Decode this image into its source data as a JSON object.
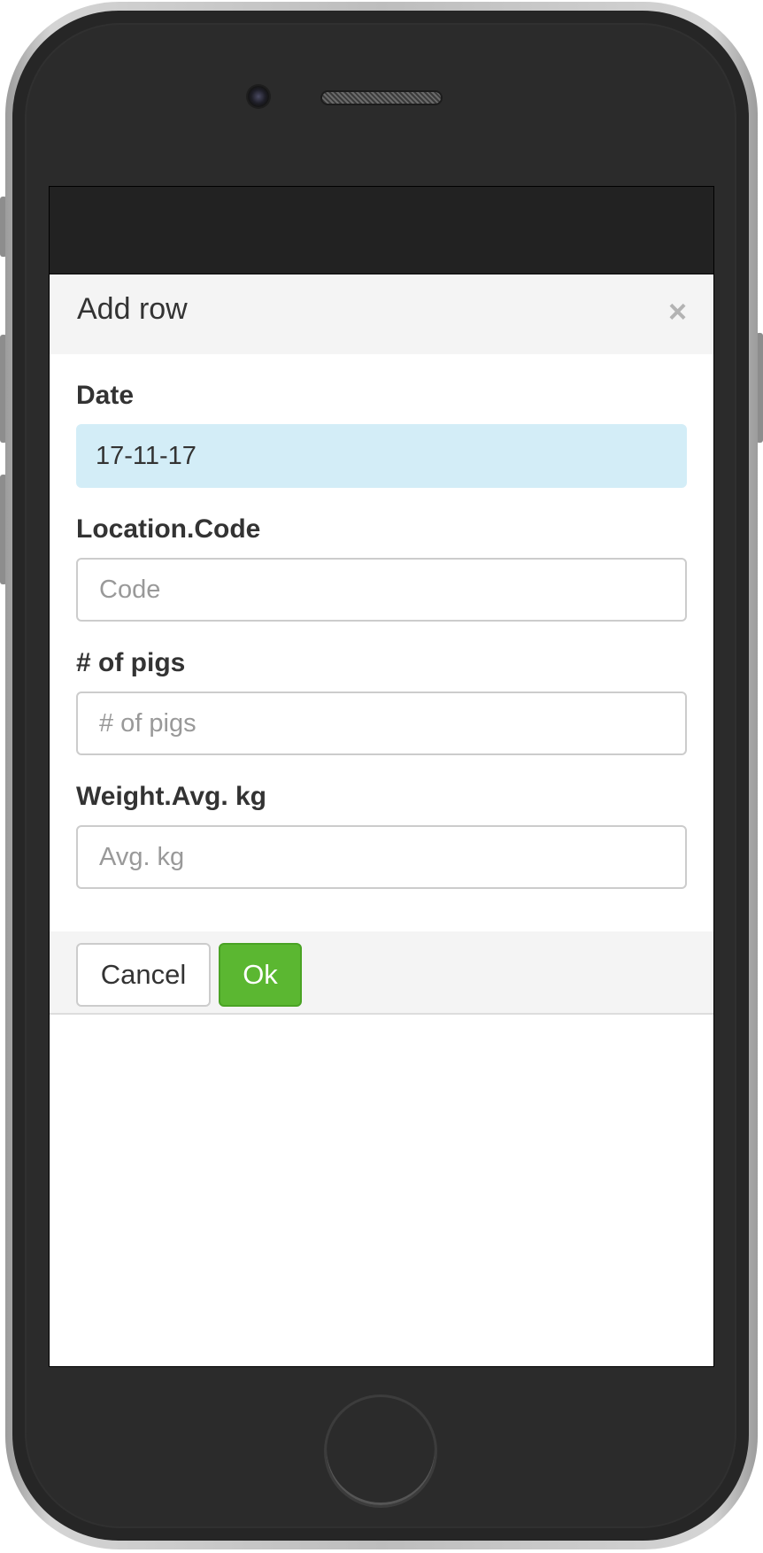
{
  "modal": {
    "title": "Add row",
    "close_symbol": "×"
  },
  "form": {
    "date": {
      "label": "Date",
      "value": "17-11-17"
    },
    "location_code": {
      "label": "Location.Code",
      "placeholder": "Code"
    },
    "pigs": {
      "label": "# of pigs",
      "placeholder": "# of pigs"
    },
    "weight": {
      "label": "Weight.Avg. kg",
      "placeholder": "Avg. kg"
    }
  },
  "footer": {
    "cancel_label": "Cancel",
    "ok_label": "Ok"
  },
  "colors": {
    "ok_button": "#5bb731",
    "date_field_background": "#d3edf7",
    "top_bar": "#222222"
  }
}
